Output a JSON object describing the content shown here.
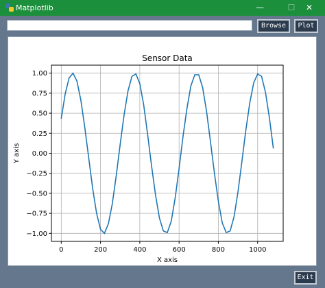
{
  "window": {
    "title": "Matplotlib",
    "minimize_symbol": "—",
    "maximize_symbol": "☐",
    "close_symbol": "✕"
  },
  "toolbar": {
    "path_value": "",
    "browse_label": "Browse",
    "plot_label": "Plot"
  },
  "footer": {
    "exit_label": "Exit"
  },
  "colors": {
    "titlebar": "#1c8f3c",
    "background": "#64778d",
    "button_bg": "#2b3a4d",
    "line": "#1f77b4"
  },
  "chart_data": {
    "type": "line",
    "title": "Sensor Data",
    "xlabel": "X axis",
    "ylabel": "Y axis",
    "xlim": [
      -50,
      1130
    ],
    "ylim": [
      -1.1,
      1.1
    ],
    "grid": true,
    "xticks": [
      0,
      200,
      400,
      600,
      800,
      1000
    ],
    "xtick_labels": [
      "0",
      "200",
      "400",
      "600",
      "800",
      "1000"
    ],
    "yticks": [
      1.0,
      0.75,
      0.5,
      0.25,
      0.0,
      -0.25,
      -0.5,
      -0.75,
      -1.0
    ],
    "ytick_labels": [
      "1.00",
      "0.75",
      "0.50",
      "0.25",
      "0.00",
      "−0.25",
      "−0.50",
      "−0.75",
      "−1.00"
    ],
    "series": [
      {
        "x": [
          0,
          20,
          40,
          60,
          80,
          100,
          120,
          140,
          160,
          180,
          200,
          220,
          240,
          260,
          280,
          300,
          320,
          340,
          360,
          380,
          400,
          420,
          440,
          460,
          480,
          500,
          520,
          540,
          560,
          580,
          600,
          620,
          640,
          660,
          680,
          700,
          720,
          740,
          760,
          780,
          800,
          820,
          840,
          860,
          880,
          900,
          920,
          940,
          960,
          980,
          1000,
          1020,
          1040,
          1060,
          1080
        ],
        "y": [
          0.43,
          0.74,
          0.94,
          1.0,
          0.9,
          0.66,
          0.32,
          -0.06,
          -0.44,
          -0.75,
          -0.95,
          -1.0,
          -0.88,
          -0.63,
          -0.28,
          0.11,
          0.48,
          0.78,
          0.96,
          0.99,
          0.87,
          0.6,
          0.23,
          -0.16,
          -0.52,
          -0.81,
          -0.97,
          -0.99,
          -0.85,
          -0.56,
          -0.19,
          0.21,
          0.56,
          0.84,
          0.98,
          0.98,
          0.82,
          0.52,
          0.14,
          -0.25,
          -0.6,
          -0.87,
          -0.99,
          -0.97,
          -0.79,
          -0.48,
          -0.1,
          0.29,
          0.63,
          0.88,
          0.99,
          0.96,
          0.76,
          0.44,
          0.06
        ]
      }
    ]
  }
}
